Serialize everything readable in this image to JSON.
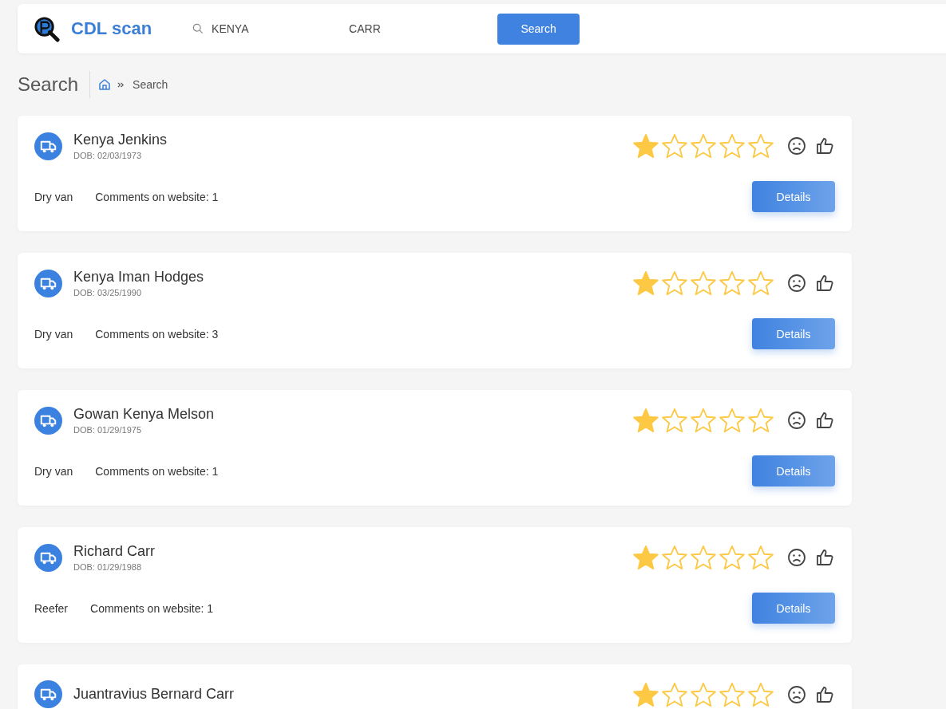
{
  "header": {
    "brand": "CDL scan",
    "first_name": "KENYA",
    "last_name": "CARR",
    "search_button": "Search"
  },
  "page": {
    "title": "Search",
    "breadcrumb": "Search"
  },
  "results": [
    {
      "name": "Kenya Jenkins",
      "dob": "DOB: 02/03/1973",
      "equipment": "Dry van",
      "comments": "Comments on website: 1",
      "stars": 1,
      "button": "Details"
    },
    {
      "name": "Kenya Iman Hodges",
      "dob": "DOB: 03/25/1990",
      "equipment": "Dry van",
      "comments": "Comments on website: 3",
      "stars": 1,
      "button": "Details"
    },
    {
      "name": "Gowan Kenya Melson",
      "dob": "DOB: 01/29/1975",
      "equipment": "Dry van",
      "comments": "Comments on website: 1",
      "stars": 1,
      "button": "Details"
    },
    {
      "name": "Richard Carr",
      "dob": "DOB: 01/29/1988",
      "equipment": "Reefer",
      "comments": "Comments on website: 1",
      "stars": 1,
      "button": "Details"
    },
    {
      "name": "Juantravius Bernard Carr",
      "stars": 1
    }
  ]
}
